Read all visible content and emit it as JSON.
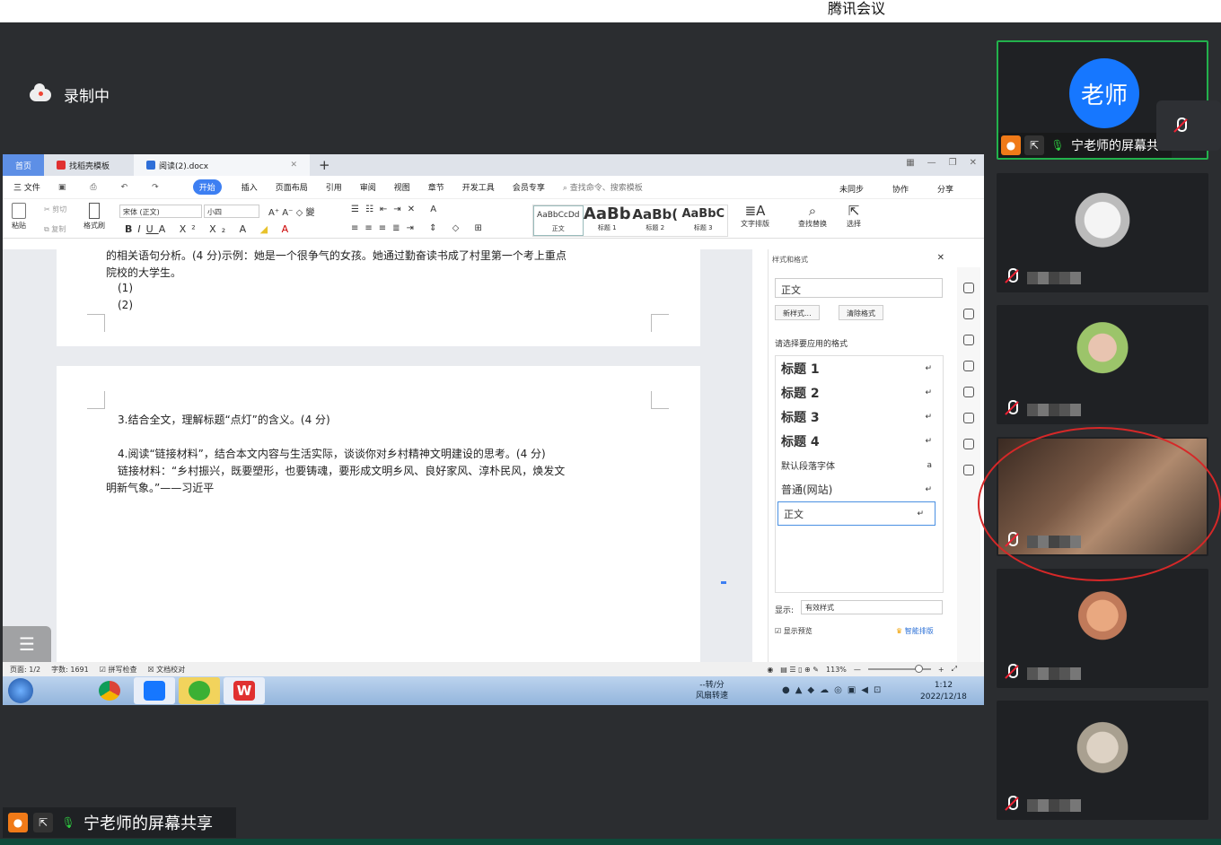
{
  "app": {
    "title": "腾讯会议"
  },
  "recording": {
    "label": "录制中"
  },
  "wps": {
    "tabs": {
      "home": "首页",
      "template": "找稻壳模板",
      "doc": "阅读(2).docx",
      "plus": "+"
    },
    "menu": {
      "file": "三 文件",
      "items": [
        "开始",
        "插入",
        "页面布局",
        "引用",
        "审阅",
        "视图",
        "章节",
        "开发工具",
        "会员专享"
      ],
      "search": "查找命令、搜索模板",
      "right": [
        "未同步",
        "协作",
        "分享"
      ]
    },
    "ribbon": {
      "paste": "粘贴",
      "cut": "剪切",
      "copy": "复制",
      "format_painter": "格式刷",
      "font": "宋体 (正文)",
      "size": "小四",
      "styles": [
        {
          "preview": "AaBbCcDd",
          "name": "正文"
        },
        {
          "preview": "AaBb",
          "name": "标题 1"
        },
        {
          "preview": "AaBb(",
          "name": "标题 2"
        },
        {
          "preview": "AaBbC",
          "name": "标题 3"
        }
      ],
      "text_layout": "文字排版",
      "find_replace": "查找替换",
      "select": "选择"
    },
    "doc": {
      "page1_line1": "的相关语句分析。(4 分)示例：她是一个很争气的女孩。她通过勤奋读书成了村里第一个考上重点",
      "page1_line2": "院校的大学生。",
      "page1_item1": "(1)",
      "page1_item2": "(2)",
      "q3": "3.结合全文，理解标题“点灯”的含义。(4 分)",
      "q4": "4.阅读“链接材料”，结合本文内容与生活实际，谈谈你对乡村精神文明建设的思考。(4 分)",
      "material1": "链接材料：“乡村振兴，既要塑形，也要铸魂，要形成文明乡风、良好家风、淳朴民风，焕发文",
      "material2": "明新气象。”——习近平"
    },
    "style_panel": {
      "title": "样式和格式",
      "current": "正文",
      "new_style": "新样式...",
      "clear_format": "清除格式",
      "apply_label": "请选择要应用的格式",
      "items": [
        "标题 1",
        "标题 2",
        "标题 3",
        "标题 4",
        "默认段落字体",
        "普通(网站)",
        "正文"
      ],
      "show_label": "显示:",
      "show_value": "有效样式",
      "preview": "显示预览",
      "smart": "智能排版"
    },
    "status": {
      "page": "页面: 1/2",
      "words": "字数: 1691",
      "spell": "拼写检查",
      "proof": "文档校对",
      "zoom": "113%"
    },
    "taskbar": {
      "fan_line1": "--转/分",
      "fan_line2": "风扇转速",
      "time": "1:12",
      "date": "2022/12/18"
    }
  },
  "share": {
    "label": "宁老师的屏幕共享"
  },
  "participants": {
    "teacher_avatar": "老师",
    "teacher_label": "宁老师的屏幕共享"
  }
}
